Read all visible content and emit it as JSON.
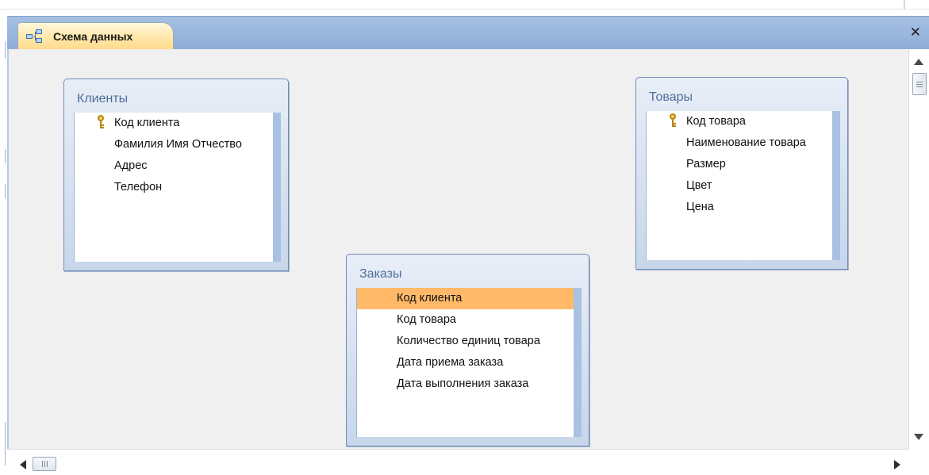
{
  "tab": {
    "title": "Схема данных"
  },
  "tables": [
    {
      "title": "Клиенты",
      "fields": [
        {
          "name": "Код клиента",
          "primary_key": true
        },
        {
          "name": "Фамилия Имя Отчество",
          "primary_key": false
        },
        {
          "name": "Адрес",
          "primary_key": false
        },
        {
          "name": "Телефон",
          "primary_key": false
        }
      ]
    },
    {
      "title": "Заказы",
      "fields": [
        {
          "name": "Код клиента",
          "primary_key": false,
          "selected": true
        },
        {
          "name": "Код товара",
          "primary_key": false
        },
        {
          "name": "Количество единиц товара",
          "primary_key": false
        },
        {
          "name": "Дата приема заказа",
          "primary_key": false
        },
        {
          "name": "Дата выполнения заказа",
          "primary_key": false
        }
      ]
    },
    {
      "title": "Товары",
      "fields": [
        {
          "name": "Код товара",
          "primary_key": true
        },
        {
          "name": "Наименование товара",
          "primary_key": false
        },
        {
          "name": "Размер",
          "primary_key": false
        },
        {
          "name": "Цвет",
          "primary_key": false
        },
        {
          "name": "Цена",
          "primary_key": false
        }
      ]
    }
  ],
  "icons": {
    "tab": "relationships-icon",
    "close": "close-icon",
    "key": "primary-key-icon"
  },
  "colors": {
    "tab_bar": "#a6c0e2",
    "tab_active": "#ffe7a8",
    "selected_field": "#ffb969",
    "table_title": "#4f6f99",
    "canvas": "#f0f0f0"
  }
}
